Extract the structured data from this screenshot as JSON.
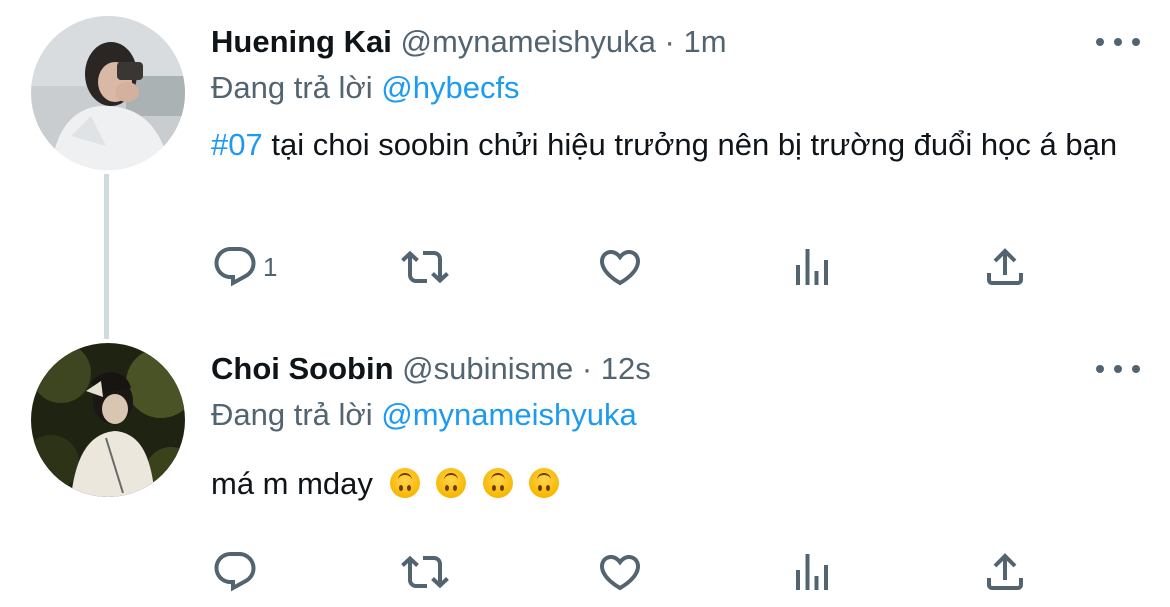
{
  "tweets": [
    {
      "display_name": "Huening Kai",
      "handle": "@mynameishyuka",
      "separator": "·",
      "time": "1m",
      "reply_prefix": "Đang trả lời",
      "reply_to": "@hybecfs",
      "hashtag": "#07",
      "text": "tại choi soobin chửi hiệu trưởng nên bị trường đuổi học á bạn",
      "reply_count": "1"
    },
    {
      "display_name": "Choi Soobin",
      "handle": "@subinisme",
      "separator": "·",
      "time": "12s",
      "reply_prefix": "Đang trả lời",
      "reply_to": "@mynameishyuka",
      "text": "má m mday",
      "emojis": [
        "upside-down-face",
        "upside-down-face",
        "upside-down-face",
        "upside-down-face"
      ],
      "reply_count": ""
    }
  ],
  "colors": {
    "link": "#1d9bf0",
    "secondary_text": "#536471",
    "primary_text": "#0f1419",
    "thread_line": "#cfd9de"
  },
  "icons": [
    "reply-icon",
    "retweet-icon",
    "like-icon",
    "views-icon",
    "share-icon",
    "more-icon"
  ]
}
